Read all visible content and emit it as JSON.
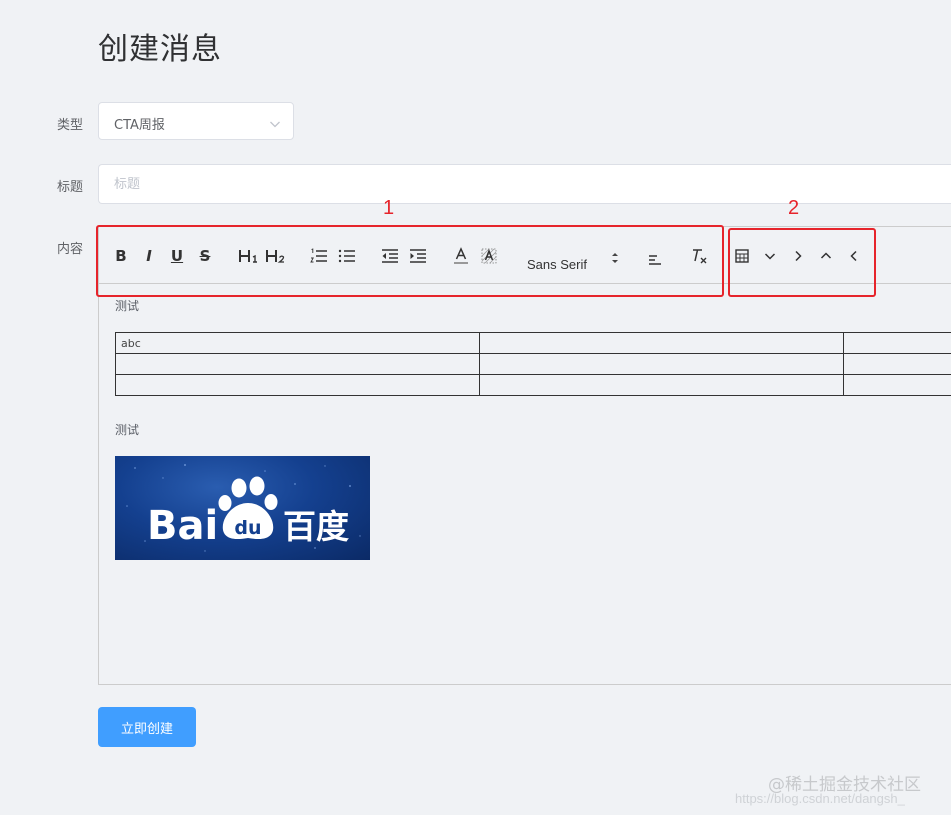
{
  "page": {
    "title": "创建消息"
  },
  "form": {
    "type_label": "类型",
    "type_value": "CTA周报",
    "title_label": "标题",
    "title_placeholder": "标题",
    "content_label": "内容",
    "submit_label": "立即创建"
  },
  "toolbar": {
    "bold": "B",
    "italic": "I",
    "underline": "U",
    "strike": "S",
    "font_picker": "Sans Serif"
  },
  "editor": {
    "paragraph_1": "测试",
    "table": [
      [
        "abc",
        "",
        ""
      ],
      [
        "",
        "",
        ""
      ],
      [
        "",
        "",
        ""
      ]
    ],
    "paragraph_2": "测试",
    "image_text": {
      "latin": "Bai",
      "paw": "du",
      "cjk": "百度"
    }
  },
  "annotations": {
    "box1": "1",
    "box2": "2"
  },
  "watermark": {
    "line1": "@稀土掘金技术社区",
    "line2": "https://blog.csdn.net/dangsh_"
  },
  "colors": {
    "primary": "#409eff",
    "annotation": "#e6242b",
    "logo_blue": "#14408f"
  }
}
